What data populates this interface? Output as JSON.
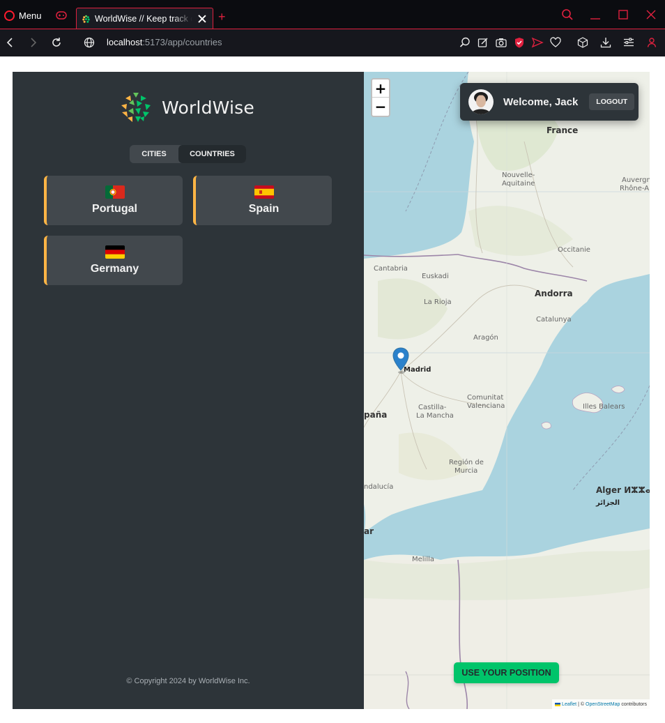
{
  "browser": {
    "menu_label": "Menu",
    "tab_title": "WorldWise // Keep track of your adventures",
    "new_tab": "+",
    "url_host": "localhost",
    "url_path": ":5173/app/countries",
    "accent": "#e0213f"
  },
  "app": {
    "logo_text": "WorldWise",
    "nav": {
      "cities": "CITIES",
      "countries": "COUNTRIES",
      "active": "countries"
    },
    "countries": [
      {
        "name": "Portugal",
        "flag": "portugal-flag-icon"
      },
      {
        "name": "Spain",
        "flag": "spain-flag-icon"
      },
      {
        "name": "Germany",
        "flag": "germany-flag-icon"
      }
    ],
    "copyright": "© Copyright 2024 by WorldWise Inc.",
    "colors": {
      "sidebar": "#2d3439",
      "card": "#42484d",
      "card_accent": "#ffb545",
      "brand_green": "#00c46a"
    }
  },
  "map": {
    "zoom_in": "+",
    "zoom_out": "−",
    "user": {
      "welcome": "Welcome, Jack",
      "logout": "LOGOUT"
    },
    "use_position": "USE YOUR POSITION",
    "attribution": {
      "leaflet": "Leaflet",
      "sep": "| ©",
      "osm": "OpenStreetMap",
      "tail": "contributors"
    },
    "labels": {
      "france": "France",
      "nouvelle": "Nouvelle-",
      "aquitaine": "Aquitaine",
      "auvergne": "Auvergne-",
      "rhone": "Rhône-Al",
      "occitanie": "Occitanie",
      "cantabria": "Cantabria",
      "euskadi": "Euskadi",
      "andorra": "Andorra",
      "larioja": "La Rioja",
      "catalunya": "Catalunya",
      "aragon": "Aragón",
      "madrid": "Madrid",
      "espana": "paña",
      "castilla": "Castilla-",
      "lamancha": "La Mancha",
      "comunitat": "Comunitat",
      "valenciana": "Valenciana",
      "illes": "Illes Balears",
      "region": "Región de",
      "murcia": "Murcia",
      "andalucia": "ndalucía",
      "alger": "Alger ⵍⵣⵣⴰⵢⴻⵔ",
      "aljazair": "الجزائر",
      "ar": "ar",
      "melilla": "Melilla"
    },
    "marker_city": "Madrid"
  }
}
